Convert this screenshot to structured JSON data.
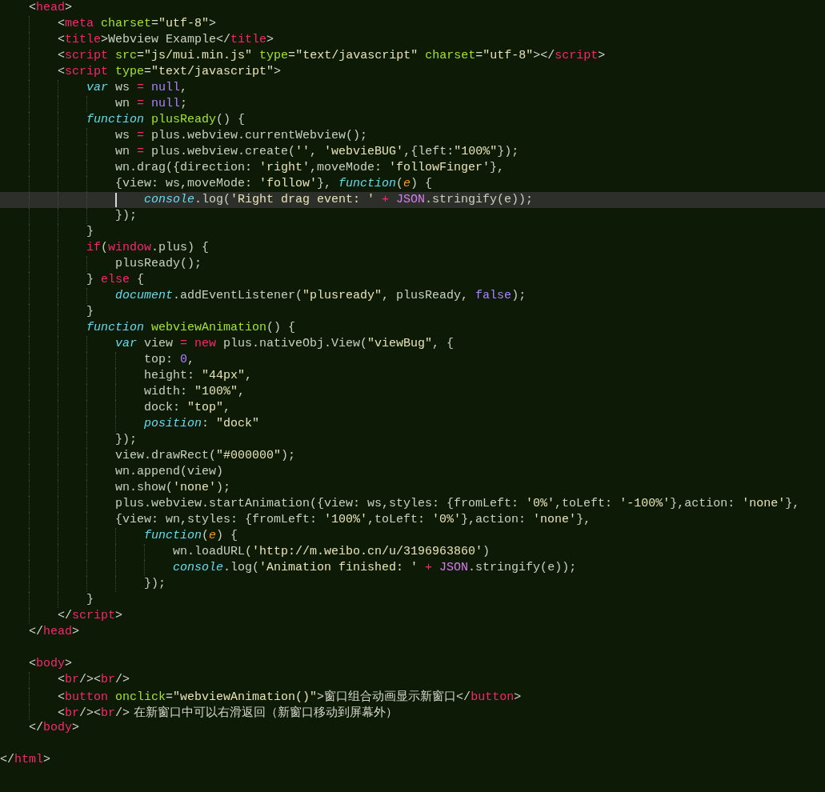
{
  "editor": {
    "lines": [
      {
        "current": false,
        "tokens": [
          {
            "kind": "p",
            "text": "<"
          },
          {
            "kind": "tag",
            "text": "head"
          },
          {
            "kind": "p",
            "text": ">"
          }
        ],
        "children": [
          {
            "current": false,
            "tokens": [
              {
                "kind": "p",
                "text": "<"
              },
              {
                "kind": "tag",
                "text": "meta"
              },
              {
                "kind": "attr",
                "text": " charset"
              },
              {
                "kind": "p",
                "text": "="
              },
              {
                "kind": "str",
                "text": "\"utf-8\""
              },
              {
                "kind": "p",
                "text": ">"
              }
            ]
          },
          {
            "current": false,
            "tokens": [
              {
                "kind": "p",
                "text": "<"
              },
              {
                "kind": "tag",
                "text": "title"
              },
              {
                "kind": "p",
                "text": ">"
              },
              {
                "kind": "id",
                "text": "Webview Example"
              },
              {
                "kind": "p",
                "text": "</"
              },
              {
                "kind": "tag",
                "text": "title"
              },
              {
                "kind": "p",
                "text": ">"
              }
            ]
          },
          {
            "current": false,
            "tokens": [
              {
                "kind": "p",
                "text": "<"
              },
              {
                "kind": "tag",
                "text": "script"
              },
              {
                "kind": "attr",
                "text": " src"
              },
              {
                "kind": "p",
                "text": "="
              },
              {
                "kind": "str",
                "text": "\"js/mui.min.js\""
              },
              {
                "kind": "attr",
                "text": " type"
              },
              {
                "kind": "p",
                "text": "="
              },
              {
                "kind": "str",
                "text": "\"text/javascript\""
              },
              {
                "kind": "attr",
                "text": " charset"
              },
              {
                "kind": "p",
                "text": "="
              },
              {
                "kind": "str",
                "text": "\"utf-8\""
              },
              {
                "kind": "p",
                "text": "></"
              },
              {
                "kind": "tag",
                "text": "script"
              },
              {
                "kind": "p",
                "text": ">"
              }
            ]
          },
          {
            "current": false,
            "tokens": [
              {
                "kind": "p",
                "text": "<"
              },
              {
                "kind": "tag",
                "text": "script"
              },
              {
                "kind": "attr",
                "text": " type"
              },
              {
                "kind": "p",
                "text": "="
              },
              {
                "kind": "str",
                "text": "\"text/javascript\""
              },
              {
                "kind": "p",
                "text": ">"
              }
            ],
            "children": [
              {
                "current": false,
                "tokens": [
                  {
                    "kind": "kw",
                    "text": "var"
                  },
                  {
                    "kind": "id",
                    "text": " ws "
                  },
                  {
                    "kind": "op",
                    "text": "="
                  },
                  {
                    "kind": "const",
                    "text": " null"
                  },
                  {
                    "kind": "id",
                    "text": ","
                  }
                ],
                "children": [
                  {
                    "current": false,
                    "tokens": [
                      {
                        "kind": "id",
                        "text": "wn "
                      },
                      {
                        "kind": "op",
                        "text": "="
                      },
                      {
                        "kind": "const",
                        "text": " null"
                      },
                      {
                        "kind": "id",
                        "text": ";"
                      }
                    ]
                  }
                ]
              },
              {
                "current": false,
                "tokens": [
                  {
                    "kind": "kw",
                    "text": "function"
                  },
                  {
                    "kind": "fn",
                    "text": " plusReady"
                  },
                  {
                    "kind": "id",
                    "text": "() {"
                  }
                ],
                "children": [
                  {
                    "current": false,
                    "tokens": [
                      {
                        "kind": "id",
                        "text": "ws "
                      },
                      {
                        "kind": "op",
                        "text": "="
                      },
                      {
                        "kind": "id",
                        "text": " plus.webview.currentWebview();"
                      }
                    ]
                  },
                  {
                    "current": false,
                    "tokens": [
                      {
                        "kind": "id",
                        "text": "wn "
                      },
                      {
                        "kind": "op",
                        "text": "="
                      },
                      {
                        "kind": "id",
                        "text": " plus.webview.create("
                      },
                      {
                        "kind": "str",
                        "text": "''"
                      },
                      {
                        "kind": "id",
                        "text": ", "
                      },
                      {
                        "kind": "str",
                        "text": "'webvieBUG'"
                      },
                      {
                        "kind": "id",
                        "text": ",{left:"
                      },
                      {
                        "kind": "str",
                        "text": "\"100%\""
                      },
                      {
                        "kind": "id",
                        "text": "});"
                      }
                    ]
                  },
                  {
                    "current": false,
                    "tokens": [
                      {
                        "kind": "id",
                        "text": "wn.drag({direction: "
                      },
                      {
                        "kind": "str",
                        "text": "'right'"
                      },
                      {
                        "kind": "id",
                        "text": ",moveMode: "
                      },
                      {
                        "kind": "str",
                        "text": "'followFinger'"
                      },
                      {
                        "kind": "id",
                        "text": "},"
                      }
                    ]
                  },
                  {
                    "current": false,
                    "tokens": [
                      {
                        "kind": "id",
                        "text": "{view: ws,moveMode: "
                      },
                      {
                        "kind": "str",
                        "text": "'follow'"
                      },
                      {
                        "kind": "id",
                        "text": "}, "
                      },
                      {
                        "kind": "kw",
                        "text": "function"
                      },
                      {
                        "kind": "id",
                        "text": "("
                      },
                      {
                        "kind": "param",
                        "text": "e"
                      },
                      {
                        "kind": "id",
                        "text": ") {"
                      }
                    ],
                    "children": [
                      {
                        "current": true,
                        "tokens": [
                          {
                            "kind": "kw",
                            "text": "console"
                          },
                          {
                            "kind": "id",
                            "text": ".log("
                          },
                          {
                            "kind": "str",
                            "text": "'Right drag event: '"
                          },
                          {
                            "kind": "op",
                            "text": " +"
                          },
                          {
                            "kind": "const2",
                            "text": " JSON"
                          },
                          {
                            "kind": "id",
                            "text": ".stringify(e));"
                          }
                        ]
                      }
                    ]
                  },
                  {
                    "current": false,
                    "tokens": [
                      {
                        "kind": "id",
                        "text": "});"
                      }
                    ]
                  }
                ]
              },
              {
                "current": false,
                "tokens": [
                  {
                    "kind": "id",
                    "text": "}"
                  }
                ]
              },
              {
                "current": false,
                "tokens": [
                  {
                    "kind": "op",
                    "text": "if"
                  },
                  {
                    "kind": "id",
                    "text": "("
                  },
                  {
                    "kind": "op",
                    "text": "window"
                  },
                  {
                    "kind": "id",
                    "text": ".plus) {"
                  }
                ],
                "children": [
                  {
                    "current": false,
                    "tokens": [
                      {
                        "kind": "id",
                        "text": "plusReady();"
                      }
                    ]
                  }
                ]
              },
              {
                "current": false,
                "tokens": [
                  {
                    "kind": "id",
                    "text": "} "
                  },
                  {
                    "kind": "op",
                    "text": "else"
                  },
                  {
                    "kind": "id",
                    "text": " {"
                  }
                ],
                "children": [
                  {
                    "current": false,
                    "tokens": [
                      {
                        "kind": "kw",
                        "text": "document"
                      },
                      {
                        "kind": "id",
                        "text": ".addEventListener("
                      },
                      {
                        "kind": "str",
                        "text": "\"plusready\""
                      },
                      {
                        "kind": "id",
                        "text": ", plusReady, "
                      },
                      {
                        "kind": "const",
                        "text": "false"
                      },
                      {
                        "kind": "id",
                        "text": ");"
                      }
                    ]
                  }
                ]
              },
              {
                "current": false,
                "tokens": [
                  {
                    "kind": "id",
                    "text": "}"
                  }
                ]
              },
              {
                "current": false,
                "tokens": [
                  {
                    "kind": "kw",
                    "text": "function"
                  },
                  {
                    "kind": "fn",
                    "text": " webviewAnimation"
                  },
                  {
                    "kind": "id",
                    "text": "() {"
                  }
                ],
                "children": [
                  {
                    "current": false,
                    "tokens": [
                      {
                        "kind": "kw",
                        "text": "var"
                      },
                      {
                        "kind": "id",
                        "text": " view "
                      },
                      {
                        "kind": "op",
                        "text": "="
                      },
                      {
                        "kind": "op",
                        "text": " new"
                      },
                      {
                        "kind": "id",
                        "text": " plus.nativeObj.View("
                      },
                      {
                        "kind": "str",
                        "text": "\"viewBug\""
                      },
                      {
                        "kind": "id",
                        "text": ", {"
                      }
                    ],
                    "children": [
                      {
                        "current": false,
                        "tokens": [
                          {
                            "kind": "id",
                            "text": "top: "
                          },
                          {
                            "kind": "const",
                            "text": "0"
                          },
                          {
                            "kind": "id",
                            "text": ","
                          }
                        ]
                      },
                      {
                        "current": false,
                        "tokens": [
                          {
                            "kind": "id",
                            "text": "height: "
                          },
                          {
                            "kind": "str",
                            "text": "\"44px\""
                          },
                          {
                            "kind": "id",
                            "text": ","
                          }
                        ]
                      },
                      {
                        "current": false,
                        "tokens": [
                          {
                            "kind": "id",
                            "text": "width: "
                          },
                          {
                            "kind": "str",
                            "text": "\"100%\""
                          },
                          {
                            "kind": "id",
                            "text": ","
                          }
                        ]
                      },
                      {
                        "current": false,
                        "tokens": [
                          {
                            "kind": "id",
                            "text": "dock: "
                          },
                          {
                            "kind": "str",
                            "text": "\"top\""
                          },
                          {
                            "kind": "id",
                            "text": ","
                          }
                        ]
                      },
                      {
                        "current": false,
                        "tokens": [
                          {
                            "kind": "kw",
                            "text": "position"
                          },
                          {
                            "kind": "id",
                            "text": ": "
                          },
                          {
                            "kind": "str",
                            "text": "\"dock\""
                          }
                        ]
                      }
                    ]
                  },
                  {
                    "current": false,
                    "tokens": [
                      {
                        "kind": "id",
                        "text": "});"
                      }
                    ]
                  },
                  {
                    "current": false,
                    "tokens": [
                      {
                        "kind": "id",
                        "text": "view.drawRect("
                      },
                      {
                        "kind": "str",
                        "text": "\"#000000\""
                      },
                      {
                        "kind": "id",
                        "text": ");"
                      }
                    ]
                  },
                  {
                    "current": false,
                    "tokens": [
                      {
                        "kind": "id",
                        "text": "wn.append(view)"
                      }
                    ]
                  },
                  {
                    "current": false,
                    "tokens": [
                      {
                        "kind": "id",
                        "text": "wn.show("
                      },
                      {
                        "kind": "str",
                        "text": "'none'"
                      },
                      {
                        "kind": "id",
                        "text": ");"
                      }
                    ]
                  },
                  {
                    "current": false,
                    "tokens": [
                      {
                        "kind": "id",
                        "text": "plus.webview.startAnimation({view: ws,styles: {fromLeft: "
                      },
                      {
                        "kind": "str",
                        "text": "'0%'"
                      },
                      {
                        "kind": "id",
                        "text": ",toLeft: "
                      },
                      {
                        "kind": "str",
                        "text": "'-100%'"
                      },
                      {
                        "kind": "id",
                        "text": "},action: "
                      },
                      {
                        "kind": "str",
                        "text": "'none'"
                      },
                      {
                        "kind": "id",
                        "text": "},"
                      }
                    ]
                  },
                  {
                    "current": false,
                    "tokens": [
                      {
                        "kind": "id",
                        "text": "{view: wn,styles: {fromLeft: "
                      },
                      {
                        "kind": "str",
                        "text": "'100%'"
                      },
                      {
                        "kind": "id",
                        "text": ",toLeft: "
                      },
                      {
                        "kind": "str",
                        "text": "'0%'"
                      },
                      {
                        "kind": "id",
                        "text": "},action: "
                      },
                      {
                        "kind": "str",
                        "text": "'none'"
                      },
                      {
                        "kind": "id",
                        "text": "},"
                      }
                    ],
                    "children": [
                      {
                        "current": false,
                        "tokens": [
                          {
                            "kind": "kw",
                            "text": "function"
                          },
                          {
                            "kind": "id",
                            "text": "("
                          },
                          {
                            "kind": "param",
                            "text": "e"
                          },
                          {
                            "kind": "id",
                            "text": ") {"
                          }
                        ],
                        "children": [
                          {
                            "current": false,
                            "tokens": [
                              {
                                "kind": "id",
                                "text": "wn.loadURL("
                              },
                              {
                                "kind": "str",
                                "text": "'http://m.weibo.cn/u/3196963860'"
                              },
                              {
                                "kind": "id",
                                "text": ")"
                              }
                            ]
                          },
                          {
                            "current": false,
                            "tokens": [
                              {
                                "kind": "kw",
                                "text": "console"
                              },
                              {
                                "kind": "id",
                                "text": ".log("
                              },
                              {
                                "kind": "str",
                                "text": "'Animation finished: '"
                              },
                              {
                                "kind": "op",
                                "text": " +"
                              },
                              {
                                "kind": "const2",
                                "text": " JSON"
                              },
                              {
                                "kind": "id",
                                "text": ".stringify(e));"
                              }
                            ]
                          }
                        ]
                      },
                      {
                        "current": false,
                        "tokens": [
                          {
                            "kind": "id",
                            "text": "});"
                          }
                        ]
                      }
                    ]
                  }
                ]
              },
              {
                "current": false,
                "tokens": [
                  {
                    "kind": "id",
                    "text": "}"
                  }
                ]
              }
            ]
          },
          {
            "current": false,
            "tokens": [
              {
                "kind": "p",
                "text": "</"
              },
              {
                "kind": "tag",
                "text": "script"
              },
              {
                "kind": "p",
                "text": ">"
              }
            ]
          }
        ]
      },
      {
        "current": false,
        "tokens": [
          {
            "kind": "p",
            "text": "</"
          },
          {
            "kind": "tag",
            "text": "head"
          },
          {
            "kind": "p",
            "text": ">"
          }
        ]
      },
      {
        "current": false
      },
      {
        "current": false,
        "tokens": [
          {
            "kind": "p",
            "text": "<"
          },
          {
            "kind": "tag",
            "text": "body"
          },
          {
            "kind": "p",
            "text": ">"
          }
        ],
        "children": [
          {
            "current": false,
            "tokens": [
              {
                "kind": "p",
                "text": "<"
              },
              {
                "kind": "tag",
                "text": "br"
              },
              {
                "kind": "p",
                "text": "/><"
              },
              {
                "kind": "tag",
                "text": "br"
              },
              {
                "kind": "p",
                "text": "/>"
              }
            ]
          },
          {
            "current": false,
            "tokens": [
              {
                "kind": "p",
                "text": "<"
              },
              {
                "kind": "tag",
                "text": "button"
              },
              {
                "kind": "attr",
                "text": " onclick"
              },
              {
                "kind": "p",
                "text": "="
              },
              {
                "kind": "str",
                "text": "\"webviewAnimation()\""
              },
              {
                "kind": "p",
                "text": ">"
              },
              {
                "kind": "text",
                "text": "窗口组合动画显示新窗口"
              },
              {
                "kind": "p",
                "text": "</"
              },
              {
                "kind": "tag",
                "text": "button"
              },
              {
                "kind": "p",
                "text": ">"
              }
            ]
          },
          {
            "current": false,
            "tokens": [
              {
                "kind": "p",
                "text": "<"
              },
              {
                "kind": "tag",
                "text": "br"
              },
              {
                "kind": "p",
                "text": "/><"
              },
              {
                "kind": "tag",
                "text": "br"
              },
              {
                "kind": "p",
                "text": "/>"
              },
              {
                "kind": "text",
                "text": " 在新窗口中可以右滑返回（新窗口移动到屏幕外）"
              }
            ]
          }
        ]
      },
      {
        "current": false,
        "tokens": [
          {
            "kind": "p",
            "text": "</"
          },
          {
            "kind": "tag",
            "text": "body"
          },
          {
            "kind": "p",
            "text": ">"
          }
        ]
      },
      {
        "current": false
      }
    ],
    "closing_line": {
      "current": false,
      "tokens": [
        {
          "kind": "p",
          "text": "</"
        },
        {
          "kind": "tag",
          "text": "html"
        },
        {
          "kind": "p",
          "text": ">"
        }
      ]
    }
  }
}
